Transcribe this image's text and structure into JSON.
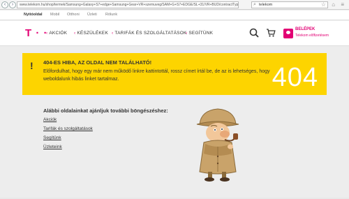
{
  "browser": {
    "url": "www.telekom.hu/shop/termek/Samsung+Galaxy+S7+edge+Samsung+Gear+VR+szemuveg/SAM+G+S7+EDGE/SL+31/VR+BUD/contractType/newPostpaid/buy",
    "search_value": "telekom"
  },
  "top_links": [
    "Nyitóoldal",
    "Mobil",
    "Otthoni",
    "Üzleti",
    "Rólunk"
  ],
  "brand": {
    "logo": "T · ·",
    "accent": "#e20074"
  },
  "menu": [
    "AKCIÓK",
    "KÉSZÜLÉKEK",
    "TARIFÁK ÉS SZOLGÁLTATÁSOK",
    "SEGÍTÜNK"
  ],
  "login": {
    "title": "BELÉPEK",
    "subtitle": "Telekom előfizetésem"
  },
  "error": {
    "icon": "!",
    "title": "404-ES HIBA, AZ OLDAL NEM TALÁLHATÓ!",
    "text": "Előfordulhat, hogy egy már nem működő linkre kattintottál, rossz címet írtál be, de az is lehetséges, hogy weboldalunk hibás linket tartalmaz.",
    "code": "404",
    "banner_color": "#fdd400"
  },
  "suggestions": {
    "title": "Alábbi oldalainkat ajánljuk további böngészéshez:",
    "links": [
      "Akciók",
      "Tarifák és szolgáltatások",
      "Segítünk",
      "Üzleteink"
    ]
  }
}
